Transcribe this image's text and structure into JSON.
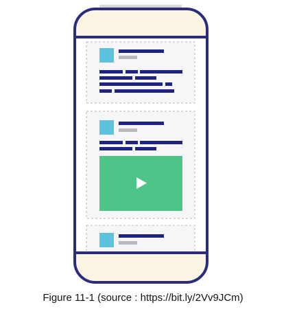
{
  "caption": "Figure 11-1 (source : https://bit.ly/2Vv9JCm)",
  "colors": {
    "phone_outline": "#2b2d7a",
    "phone_bezel": "#fbf6e4",
    "screen_background": "#ffffff",
    "card_background": "#f6f6f8",
    "card_border": "#bbbbbb",
    "avatar": "#5bc4dc",
    "text_lines": "#1f2382",
    "meta_lines": "#b8b8bf",
    "video": "#4dc488",
    "play_icon": "#ffffff",
    "side_tabs": "#d8d8d8"
  },
  "feed": {
    "cards": [
      {
        "kind": "text-post",
        "avatar_icon": "avatar-icon",
        "lines": 4
      },
      {
        "kind": "video-post",
        "avatar_icon": "avatar-icon",
        "media_icon": "play-icon",
        "lines": 2
      },
      {
        "kind": "text-post",
        "avatar_icon": "avatar-icon",
        "lines": 0
      }
    ]
  }
}
